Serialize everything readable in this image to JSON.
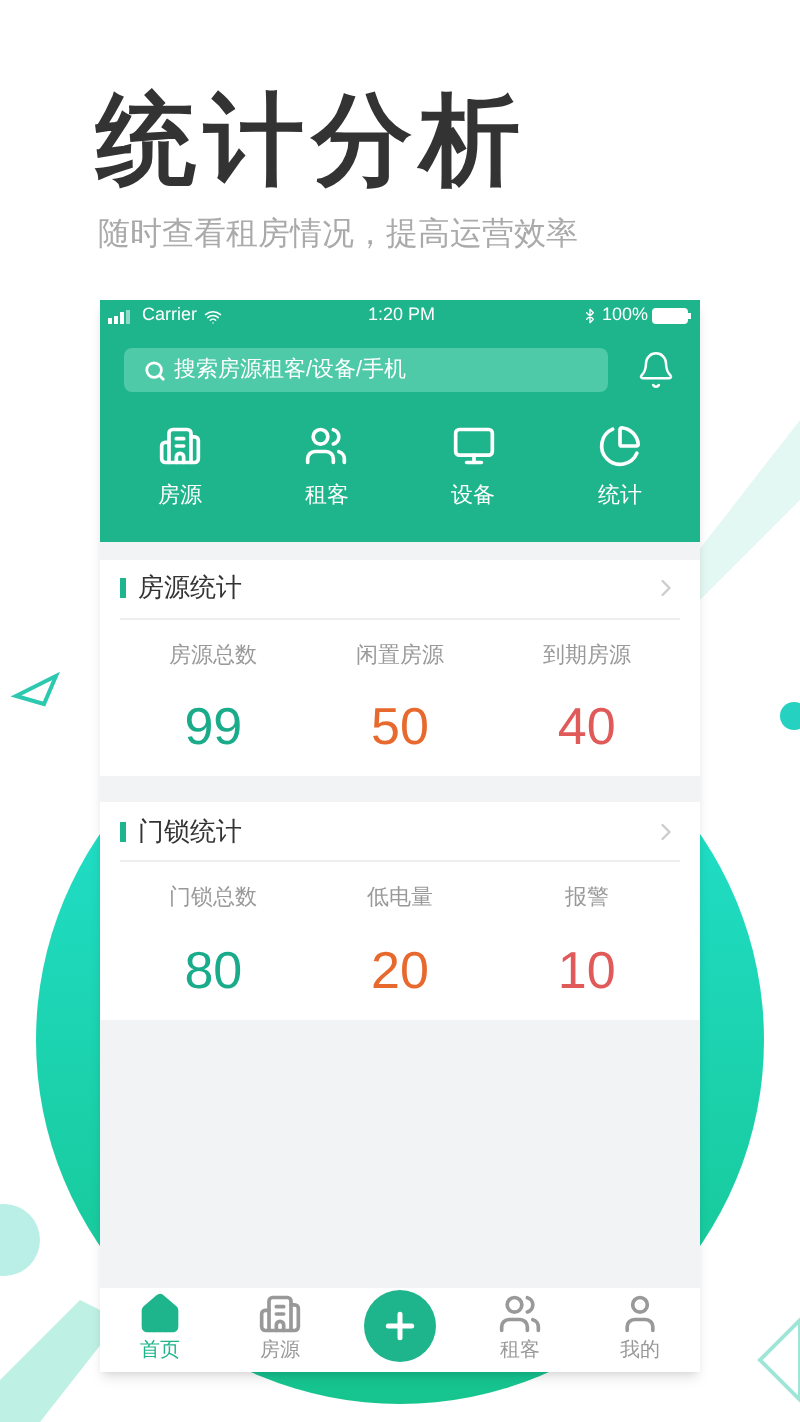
{
  "headline": "统计分析",
  "subtitle": "随时查看租房情况，提高运营效率",
  "status_bar": {
    "carrier": "Carrier",
    "time": "1:20 PM",
    "battery": "100%"
  },
  "search": {
    "placeholder": "搜索房源租客/设备/手机"
  },
  "shortcuts": [
    {
      "label": "房源",
      "kind": "building"
    },
    {
      "label": "租客",
      "kind": "people"
    },
    {
      "label": "设备",
      "kind": "device"
    },
    {
      "label": "统计",
      "kind": "chart"
    }
  ],
  "sections": [
    {
      "title": "房源统计",
      "stats": [
        {
          "label": "房源总数",
          "value": "99",
          "color": "#1aab8a"
        },
        {
          "label": "闲置房源",
          "value": "50",
          "color": "#e8692e"
        },
        {
          "label": "到期房源",
          "value": "40",
          "color": "#e05a5a"
        }
      ]
    },
    {
      "title": "门锁统计",
      "stats": [
        {
          "label": "门锁总数",
          "value": "80",
          "color": "#1aab8a"
        },
        {
          "label": "低电量",
          "value": "20",
          "color": "#e8692e"
        },
        {
          "label": "报警",
          "value": "10",
          "color": "#e05a5a"
        }
      ]
    }
  ],
  "tab_bar": [
    {
      "label": "首页",
      "kind": "home",
      "selected": true
    },
    {
      "label": "房源",
      "kind": "building",
      "selected": false
    },
    {
      "kind": "add",
      "selected": false
    },
    {
      "label": "租客",
      "kind": "people",
      "selected": false
    },
    {
      "label": "我的",
      "kind": "person",
      "selected": false
    }
  ]
}
